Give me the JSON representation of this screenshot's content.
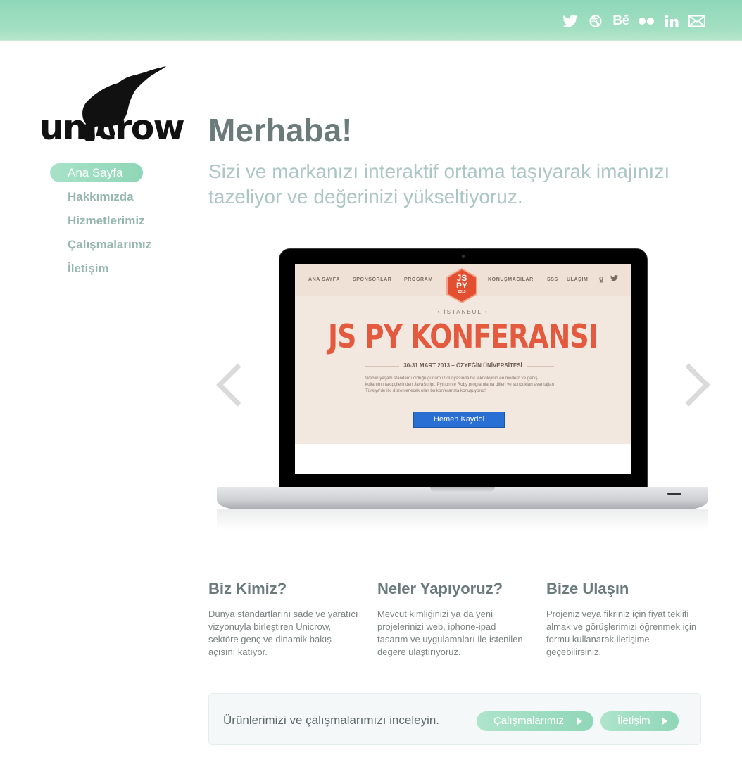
{
  "social": [
    {
      "name": "twitter",
      "icon": "twitter-icon"
    },
    {
      "name": "dribbble",
      "icon": "dribbble-icon"
    },
    {
      "name": "behance",
      "icon": "behance-icon",
      "text": "Bē"
    },
    {
      "name": "flickr",
      "icon": "flickr-icon"
    },
    {
      "name": "linkedin",
      "icon": "linkedin-icon",
      "text": "in"
    },
    {
      "name": "email",
      "icon": "mail-icon"
    }
  ],
  "logo": {
    "text": "unicrow"
  },
  "nav": {
    "items": [
      {
        "label": "Ana Sayfa",
        "active": true
      },
      {
        "label": "Hakkımızda",
        "active": false
      },
      {
        "label": "Hizmetlerimiz",
        "active": false
      },
      {
        "label": "Çalışmalarımız",
        "active": false
      },
      {
        "label": "İletişim",
        "active": false
      }
    ]
  },
  "hero": {
    "title": "Merhaba!",
    "subtitle": "Sizi ve markanızı interaktif ortama taşıyarak imajınızı tazeliyor ve değerinizi yükseltiyoruz."
  },
  "slide": {
    "nav_left": [
      "ANA SAYFA",
      "SPONSORLAR",
      "PROGRAM"
    ],
    "nav_right": [
      "KONUŞMACILAR",
      "SSS",
      "ULAŞIM"
    ],
    "logo_line1": "JS",
    "logo_line2": "PY",
    "logo_year": "2013",
    "city": "• İSTANBUL •",
    "title": "JS PY KONFERANSI",
    "date": "30-31 MART 2013 – ÖZYEĞİN ÜNİVERSİTESİ",
    "desc": "Web'in yaşam standardı olduğu günümüz dünyasında bu teknolojinin en modern ve geniş kullanımlı takipçilerinden JavaScript, Python ve Ruby programlama dilleri ve sundukları avantajları Türkiye'de ilki düzenlenecek olan bu konferansta konuşuyoruz!",
    "button": "Hemen Kaydol"
  },
  "columns": [
    {
      "title": "Biz Kimiz?",
      "text": "Dünya standartlarını sade ve yaratıcı vizyonuyla birleştiren Unicrow, sektöre genç ve dinamik bakış açısını katıyor."
    },
    {
      "title": "Neler Yapıyoruz?",
      "text": "Mevcut kimliğinizi ya da yeni projelerinizi web, iphone-ipad tasarım ve uygulamaları ile istenilen değere ulaştırıyoruz."
    },
    {
      "title": "Bize Ulaşın",
      "text": "Projeniz veya fikriniz için fiyat teklifi almak ve görüşlerimizi öğrenmek için formu kullanarak iletişime geçebilirsiniz."
    }
  ],
  "cta": {
    "text": "Ürünlerimizi ve çalışmalarımızı inceleyin.",
    "button1": "Çalışmalarımız",
    "button2": "İletişim"
  },
  "colors": {
    "accent": "#8fd6b7",
    "heading": "#6a7b7a",
    "subtitle": "#acc6c3",
    "slide_title": "#e45a3e",
    "slide_button": "#2a6fd3"
  }
}
